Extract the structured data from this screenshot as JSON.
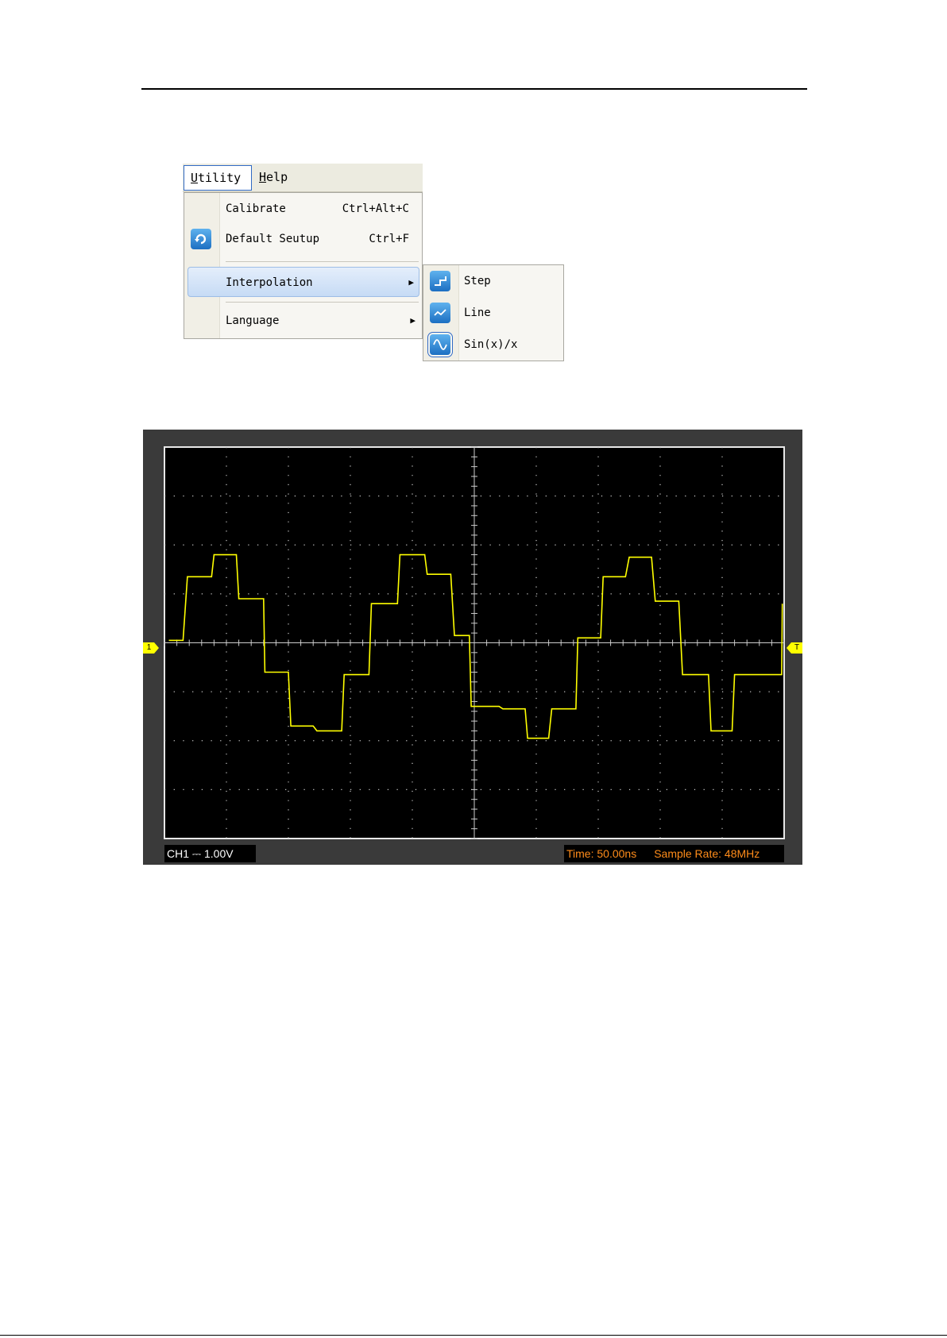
{
  "menubar": {
    "utility": {
      "mnemonic": "U",
      "rest": "tility"
    },
    "help": {
      "mnemonic": "H",
      "rest": "elp"
    }
  },
  "utility_menu": {
    "items": [
      {
        "label": "Calibrate",
        "shortcut": "Ctrl+Alt+C",
        "icon": ""
      },
      {
        "label": "Default Seutup",
        "shortcut": "Ctrl+F",
        "icon": "default-setup-icon"
      },
      {
        "label": "Interpolation",
        "has_submenu": true,
        "highlighted": true
      },
      {
        "label": "Language",
        "has_submenu": true
      }
    ]
  },
  "interpolation_submenu": {
    "items": [
      {
        "label": "Step",
        "icon": "step-icon"
      },
      {
        "label": "Line",
        "icon": "line-icon"
      },
      {
        "label": "Sin(x)/x",
        "icon": "sine-icon",
        "selected": true
      }
    ]
  },
  "scope": {
    "channel_marker": "1",
    "trigger_marker": "T",
    "channel_label": "CH1",
    "coupling_symbol": "⎓",
    "volts_per_div": "1.00V",
    "time_label": "Time: 50.00ns",
    "sample_rate_label": "Sample Rate: 48MHz",
    "colors": {
      "trace": "#ffff00",
      "grid": "#cccccc",
      "screen": "#000000",
      "bezel": "#3a3a3a",
      "status_right": "#ff8c1a"
    }
  },
  "chart_data": {
    "type": "line",
    "interpolation": "Step",
    "x_divisions": 10,
    "y_divisions": 8,
    "xlim": [
      0,
      10
    ],
    "ylim": [
      -4,
      4
    ],
    "series": [
      {
        "color": "#ffff00",
        "x": [
          0.07,
          0.3,
          0.37,
          0.76,
          0.8,
          1.16,
          1.2,
          1.6,
          1.62,
          2.0,
          2.04,
          2.4,
          2.46,
          2.86,
          2.9,
          3.3,
          3.34,
          3.76,
          3.8,
          4.2,
          4.24,
          4.62,
          4.68,
          4.92,
          4.95,
          5.4,
          5.46,
          5.82,
          5.86,
          6.2,
          6.25,
          6.64,
          6.67,
          7.04,
          7.08,
          7.44,
          7.5,
          7.86,
          7.92,
          8.3,
          8.36,
          8.78,
          8.82,
          9.16,
          9.2,
          9.56,
          9.62,
          9.96,
          9.97
        ],
        "y": [
          0.05,
          0.05,
          1.35,
          1.35,
          1.8,
          1.8,
          0.9,
          0.9,
          -0.6,
          -0.6,
          -1.7,
          -1.7,
          -1.8,
          -1.8,
          -0.65,
          -0.65,
          0.8,
          0.8,
          1.8,
          1.8,
          1.4,
          1.4,
          0.15,
          0.15,
          -1.3,
          -1.3,
          -1.35,
          -1.35,
          -1.95,
          -1.95,
          -1.35,
          -1.35,
          0.1,
          0.1,
          1.35,
          1.35,
          1.75,
          1.75,
          0.85,
          0.85,
          -0.65,
          -0.65,
          -1.8,
          -1.8,
          -0.65,
          -0.65,
          -0.65,
          -0.65,
          0.8
        ]
      }
    ]
  }
}
